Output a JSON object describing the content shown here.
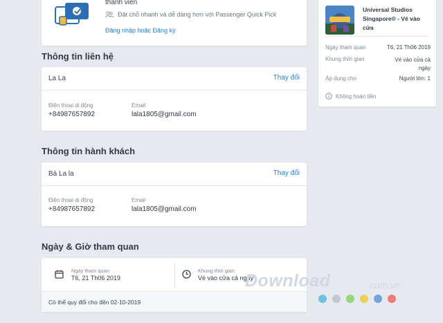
{
  "login": {
    "title_fragment": "thành viên",
    "perk_text": "Đặt chỗ nhanh và dễ dàng hơn với Passenger Quick Pick",
    "link_text": "Đăng nhập hoặc Đăng ký"
  },
  "contact_section": {
    "title": "Thông tin liên hệ",
    "name": "La La",
    "change_label": "Thay đổi",
    "phone_label": "Điện thoại di động",
    "phone_value": "+84987657892",
    "email_label": "Email",
    "email_value": "lala1805@gmail.com"
  },
  "passenger_section": {
    "title": "Thông tin hành khách",
    "name": "Bà La la",
    "change_label": "Thay đổi",
    "phone_label": "Điện thoại di động",
    "phone_value": "+84987657892",
    "email_label": "Email",
    "email_value": "lala1805@gmail.com"
  },
  "visit_section": {
    "title": "Ngày & Giờ tham quan",
    "date_label": "Ngày tham quan",
    "date_value": "T6, 21 Th06 2019",
    "slot_label": "Khung thời gian",
    "slot_value": "Vé vào cửa cả ngày",
    "reschedule_note": "Có thể quy đổi cho đến 02-10-2019"
  },
  "summary": {
    "product_title": "Universal Studios Singapore® - Vé vào cửa",
    "rows": [
      {
        "label": "Ngày tham quan",
        "value": "T6, 21 Th06 2019"
      },
      {
        "label": "Khung thời gian",
        "value": "Vé vào cửa cả ngày"
      },
      {
        "label": "Áp dụng cho",
        "value": "Người lớn: 1"
      }
    ],
    "non_refundable": "Không hoàn tiền"
  },
  "watermark": {
    "word": "Download",
    "domain": ".com.vn",
    "dot_colors": [
      "#58b9e6",
      "#b9c2cb",
      "#8cd16a",
      "#f1c93c",
      "#5a98d6",
      "#ee6666"
    ]
  },
  "colors": {
    "link": "#1a84d8",
    "background": "#e6eaee"
  }
}
